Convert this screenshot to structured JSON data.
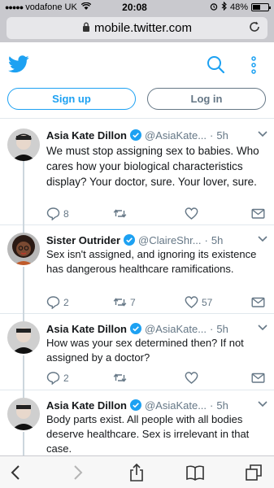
{
  "status_bar": {
    "carrier": "vodafone UK",
    "time": "20:08",
    "battery": "48%",
    "battery_level": 0.48
  },
  "browser": {
    "url": "mobile.twitter.com"
  },
  "header": {
    "logo": "twitter-bird-icon",
    "search_icon": "search-icon",
    "more_icon": "more-vertical-icon"
  },
  "auth": {
    "signup_label": "Sign up",
    "login_label": "Log in"
  },
  "tweets": [
    {
      "name": "Asia Kate Dillon",
      "handle": "@AsiaKate...",
      "time": "5h",
      "text": "We must stop assigning sex to babies. Who cares how your biological characteristics display? Your doctor, sure. Your lover, sure.",
      "replies": "8",
      "retweets": "",
      "likes": ""
    },
    {
      "name": "Sister Outrider",
      "handle": "@ClaireShr...",
      "time": "5h",
      "text": "Sex isn't assigned, and ignoring its existence has dangerous healthcare ramifications.",
      "replies": "2",
      "retweets": "7",
      "likes": "57"
    },
    {
      "name": "Asia Kate Dillon",
      "handle": "@AsiaKate...",
      "time": "5h",
      "text": "How was your sex determined then? If not assigned by a doctor?",
      "replies": "2",
      "retweets": "",
      "likes": ""
    },
    {
      "name": "Asia Kate Dillon",
      "handle": "@AsiaKate...",
      "time": "5h",
      "text": "Body parts exist. All people with all bodies deserve healthcare. Sex is irrelevant in that case.",
      "replies": "",
      "retweets": "",
      "likes": ""
    }
  ],
  "toolbar": {
    "icons": [
      "back-icon",
      "forward-icon",
      "share-icon",
      "bookmarks-icon",
      "tabs-icon"
    ]
  },
  "colors": {
    "twitter_blue": "#1da1f2",
    "secondary_text": "#657786",
    "browser_chrome": "#c9c9ce"
  }
}
